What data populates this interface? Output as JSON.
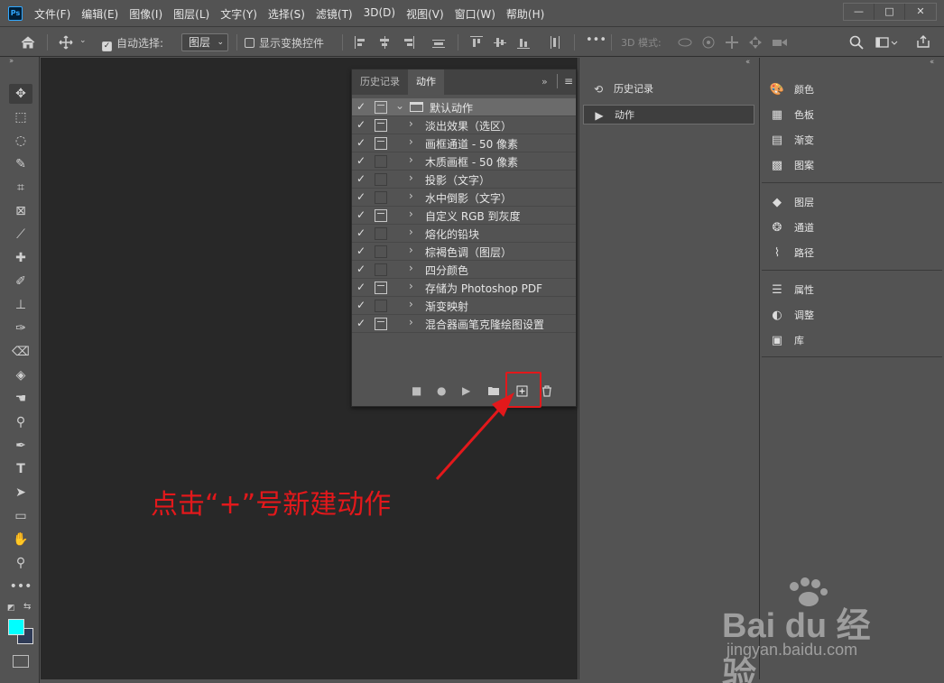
{
  "app": {
    "logo": "Ps"
  },
  "menu": [
    "文件(F)",
    "编辑(E)",
    "图像(I)",
    "图层(L)",
    "文字(Y)",
    "选择(S)",
    "滤镜(T)",
    "3D(D)",
    "视图(V)",
    "窗口(W)",
    "帮助(H)"
  ],
  "window_controls": {
    "minimize": "—",
    "restore": "□",
    "close": "✕"
  },
  "options": {
    "auto_select_label": "自动选择:",
    "auto_select_value": "图层",
    "show_transform_label": "显示变换控件",
    "more": "•••",
    "mode_3d": "3D 模式:"
  },
  "actions_panel": {
    "tabs": [
      "历史记录",
      "动作"
    ],
    "active_tab": 1,
    "set_name": "默认动作",
    "actions": [
      {
        "label": "淡出效果（选区）",
        "checked": true,
        "dialog": true
      },
      {
        "label": "画框通道 - 50 像素",
        "checked": true,
        "dialog": true
      },
      {
        "label": "木质画框 - 50 像素",
        "checked": true,
        "dialog": false
      },
      {
        "label": "投影（文字）",
        "checked": true,
        "dialog": false
      },
      {
        "label": "水中倒影（文字）",
        "checked": true,
        "dialog": false
      },
      {
        "label": "自定义 RGB 到灰度",
        "checked": true,
        "dialog": true
      },
      {
        "label": "熔化的铅块",
        "checked": true,
        "dialog": false
      },
      {
        "label": "棕褐色调（图层）",
        "checked": true,
        "dialog": false
      },
      {
        "label": "四分颜色",
        "checked": true,
        "dialog": false
      },
      {
        "label": "存储为 Photoshop PDF",
        "checked": true,
        "dialog": true
      },
      {
        "label": "渐变映射",
        "checked": true,
        "dialog": false
      },
      {
        "label": "混合器画笔克隆绘图设置",
        "checked": true,
        "dialog": true
      }
    ]
  },
  "mid_panel": {
    "items": [
      {
        "label": "历史记录",
        "icon": "history-icon"
      },
      {
        "label": "动作",
        "icon": "play-icon"
      }
    ]
  },
  "right_panel": {
    "group1": [
      "颜色",
      "色板",
      "渐变",
      "图案"
    ],
    "group2": [
      "图层",
      "通道",
      "路径"
    ],
    "group3": [
      "属性",
      "调整",
      "库"
    ]
  },
  "annotation": {
    "text": "点击“+”号新建动作",
    "color": "#e3181b"
  },
  "watermark": {
    "brand": "Bai du 经验",
    "url": "jingyan.baidu.com"
  },
  "colors": {
    "foreground": "#00ffff",
    "background": "#2f3b57",
    "canvas": "#282828",
    "panel": "#535353"
  }
}
